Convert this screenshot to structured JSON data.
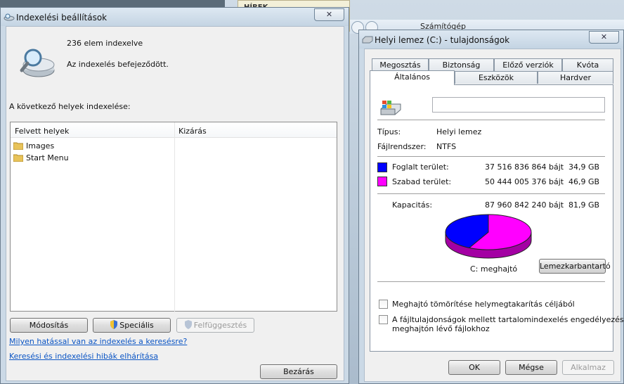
{
  "background": {
    "menu_label": "HÍREK",
    "address_crumb": "Számítógép"
  },
  "index_window": {
    "title": "Indexelési beállítások",
    "close_glyph": "✕",
    "status_count": "236 elem indexelve",
    "status_message": "Az indexelés befejeződött.",
    "section_label": "A következő helyek indexelése:",
    "list": {
      "columns": [
        "Felvett helyek",
        "Kizárás"
      ],
      "items": [
        "Images",
        "Start Menu"
      ]
    },
    "buttons": {
      "modify": "Módosítás",
      "advanced": "Speciális",
      "pause": "Felfüggesztés",
      "close": "Bezárás"
    },
    "links": [
      "Milyen hatással van az indexelés a keresésre?",
      "Keresési és indexelési hibák elhárítása"
    ]
  },
  "properties_window": {
    "title": "Helyi lemez (C:) - tulajdonságok",
    "close_glyph": "✕",
    "tabs_row1": [
      "Megosztás",
      "Biztonság",
      "Előző verziók",
      "Kvóta"
    ],
    "tabs_row2": [
      "Általános",
      "Eszközök",
      "Hardver"
    ],
    "active_tab": "Általános",
    "drive_name_value": "",
    "type_label": "Típus:",
    "type_value": "Helyi lemez",
    "fs_label": "Fájlrendszer:",
    "fs_value": "NTFS",
    "used": {
      "label": "Foglalt terület:",
      "bytes": "37 516 836 864 bájt",
      "size": "34,9 GB",
      "color": "#0000ff"
    },
    "free": {
      "label": "Szabad terület:",
      "bytes": "50 444 005 376 bájt",
      "size": "46,9 GB",
      "color": "#ff00ff"
    },
    "capacity": {
      "label": "Kapacitás:",
      "bytes": "87 960 842 240 bájt",
      "size": "81,9 GB"
    },
    "used_fraction": 0.4265,
    "drive_caption": "C: meghajtó",
    "cleanup_button": "Lemezkarbantartó",
    "checkboxes": [
      {
        "label": "Meghajtó tömörítése helymegtakarítás céljából",
        "checked": false
      },
      {
        "label_line1": "A fájltulajdonságok mellett tartalomindexelés engedélyezése a",
        "label_line2": "meghajtón lévő fájlokhoz",
        "checked": false
      }
    ],
    "buttons": {
      "ok": "OK",
      "cancel": "Mégse",
      "apply": "Alkalmaz"
    }
  }
}
